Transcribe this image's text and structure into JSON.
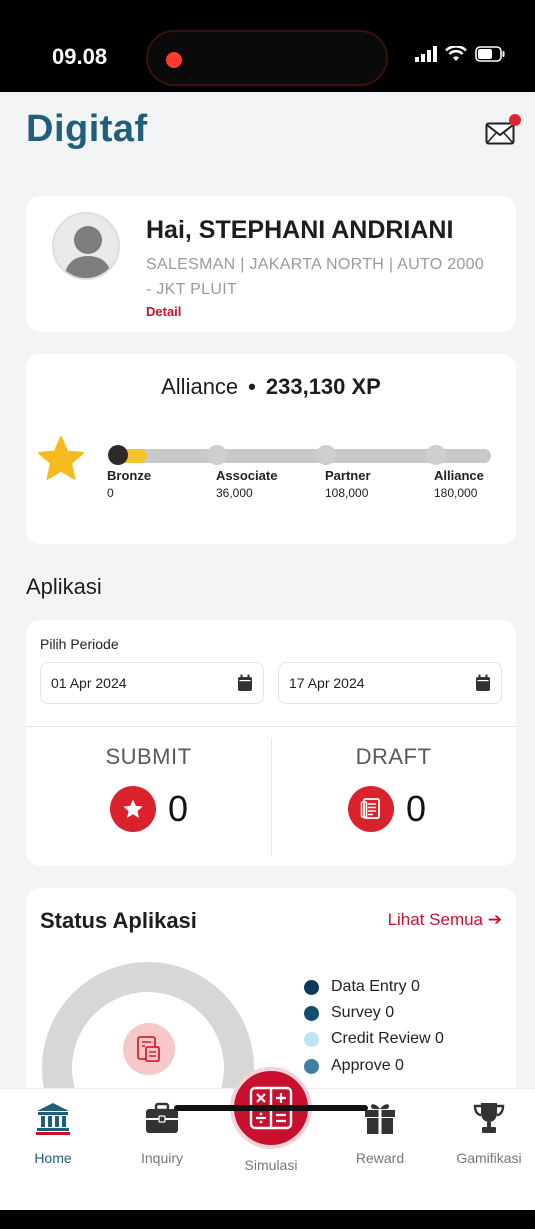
{
  "status_bar": {
    "time": "09.08"
  },
  "header": {
    "logo": "Digitaf",
    "mail_icon": "mail-icon",
    "has_notification": true
  },
  "profile": {
    "greeting": "Hai, STEPHANI ANDRIANI",
    "role": "SALESMAN | JAKARTA NORTH | AUTO 2000 - JKT PLUIT",
    "detail_link": "Detail"
  },
  "tier": {
    "current_tier": "Alliance",
    "xp": "233,130 XP",
    "progress_fraction": 0.1,
    "milestones": [
      {
        "label": "Bronze",
        "value": "0"
      },
      {
        "label": "Associate",
        "value": "36,000"
      },
      {
        "label": "Partner",
        "value": "108,000"
      },
      {
        "label": "Alliance",
        "value": "180,000"
      }
    ]
  },
  "aplikasi": {
    "section_title": "Aplikasi",
    "periode_label": "Pilih Periode",
    "start_date": "01 Apr 2024",
    "end_date": "17 Apr 2024",
    "submit_label": "SUBMIT",
    "submit_count": "0",
    "draft_label": "DRAFT",
    "draft_count": "0"
  },
  "status_aplikasi": {
    "title": "Status Aplikasi",
    "see_all": "Lihat Semua",
    "legend": [
      {
        "label": "Data Entry 0",
        "color": "#0b3a5c"
      },
      {
        "label": "Survey 0",
        "color": "#0f4f6e"
      },
      {
        "label": "Credit Review 0",
        "color": "#bfe3f5"
      },
      {
        "label": "Approve 0",
        "color": "#3f7fa5"
      }
    ]
  },
  "bottom_nav": {
    "items": [
      {
        "label": "Home",
        "icon": "bank-icon",
        "active": true
      },
      {
        "label": "Inquiry",
        "icon": "briefcase-icon",
        "active": false
      },
      {
        "label": "Simulasi",
        "icon": "calculator-icon",
        "active": false
      },
      {
        "label": "Reward",
        "icon": "gift-icon",
        "active": false
      },
      {
        "label": "Gamifikasi",
        "icon": "trophy-icon",
        "active": false
      }
    ]
  }
}
